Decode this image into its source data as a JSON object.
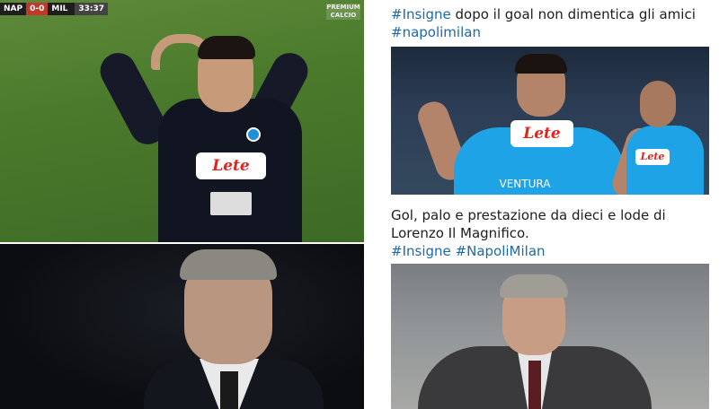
{
  "left": {
    "scoreboard": {
      "home": "NAP",
      "score": "0-0",
      "away": "MIL",
      "time": "33:37"
    },
    "broadcaster_logo": "PREMIUM",
    "broadcaster_sub": "CALCIO",
    "jersey_sponsor": "Lete"
  },
  "right": {
    "tweet1": {
      "hashtag_1": "#Insigne",
      "text": " dopo il goal non dimentica gli amici",
      "hashtag_2": "#napolimilan"
    },
    "image1": {
      "sponsor_main": "Lete",
      "sponsor_second": "Lete",
      "jersey_caption": "VENTURA"
    },
    "tweet2": {
      "line1": "Gol, palo e prestazione da dieci e lode di",
      "line2": "Lorenzo Il Magnifico.",
      "hashtag_1": "#Insigne",
      "hashtag_2": "#NapoliMilan"
    }
  }
}
